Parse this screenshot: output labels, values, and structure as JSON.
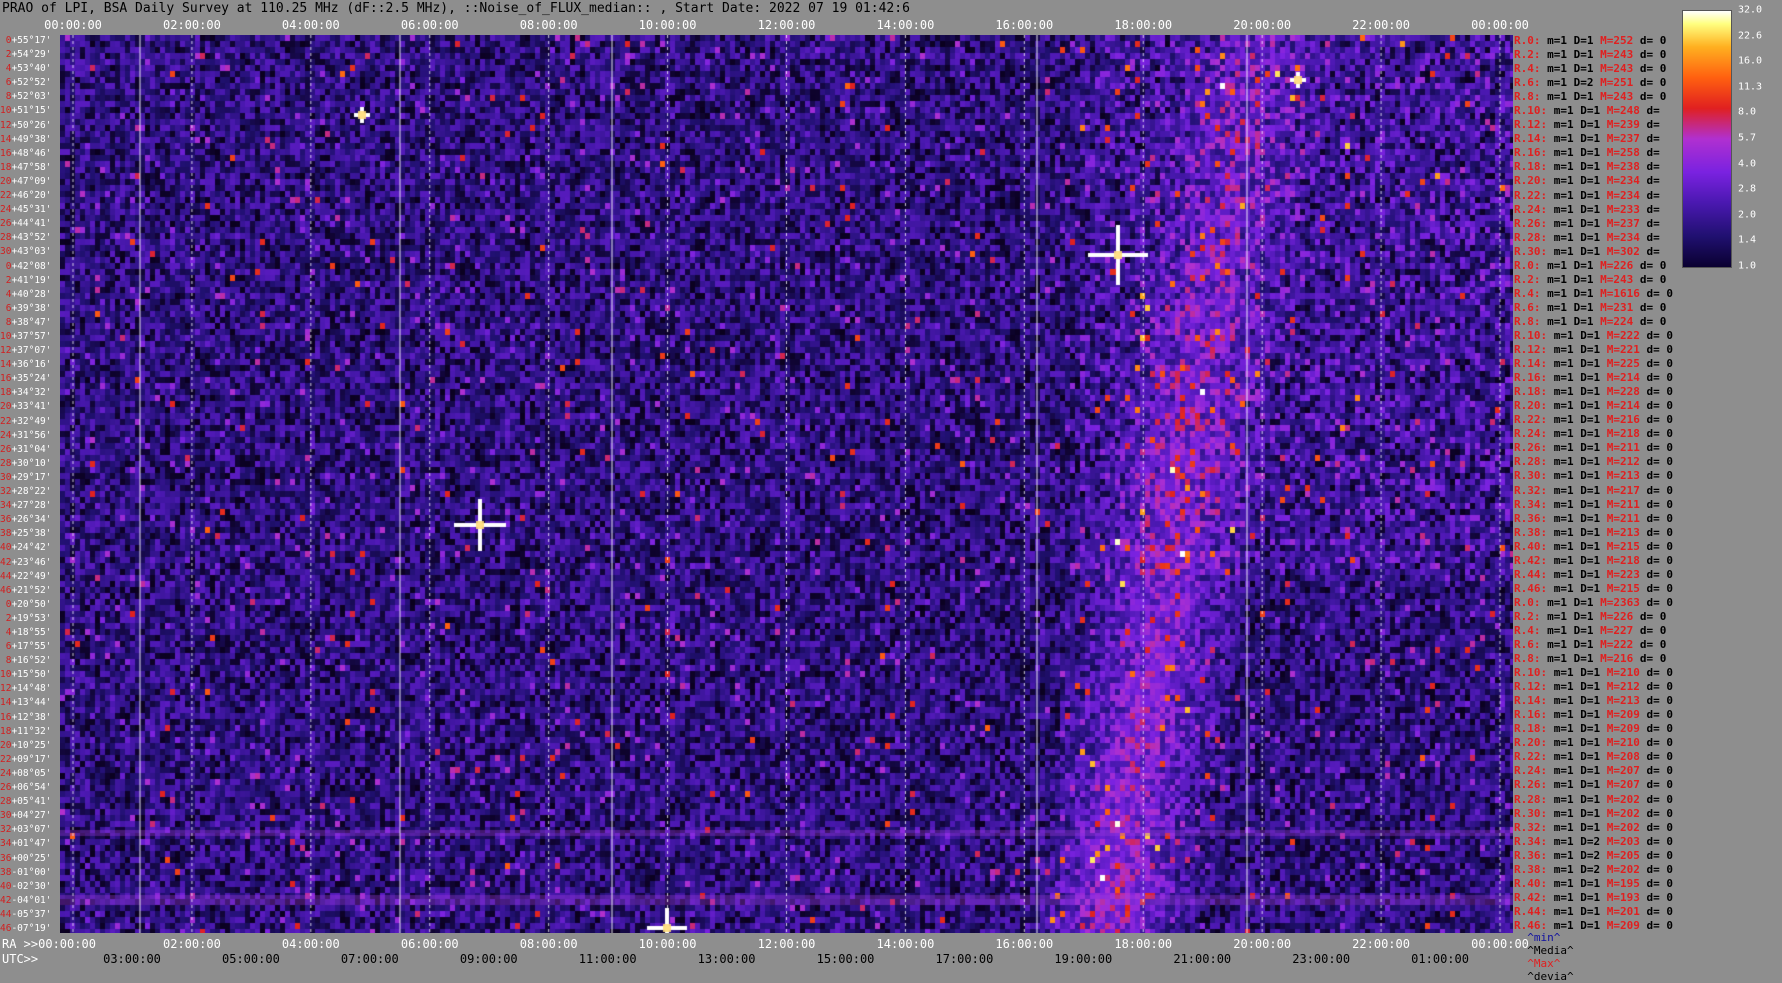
{
  "title": "PRAO of LPI, BSA Daily Survey at 110.25 MHz (dF::2.5 MHz), ::Noise_of_FLUX_median:: , Start Date: 2022 07 19 01:42:6",
  "top_ticks": [
    "00:00:00",
    "02:00:00",
    "04:00:00",
    "06:00:00",
    "08:00:00",
    "10:00:00",
    "12:00:00",
    "14:00:00",
    "16:00:00",
    "18:00:00",
    "20:00:00",
    "22:00:00",
    "00:00:00"
  ],
  "ra_label": "RA >>00:00:00",
  "ra_ticks": [
    "02:00:00",
    "04:00:00",
    "06:00:00",
    "08:00:00",
    "10:00:00",
    "12:00:00",
    "14:00:00",
    "16:00:00",
    "18:00:00",
    "20:00:00",
    "22:00:00",
    "00:00:00"
  ],
  "utc_label": "UTC>>",
  "utc_ticks": [
    "03:00:00",
    "05:00:00",
    "07:00:00",
    "09:00:00",
    "11:00:00",
    "13:00:00",
    "15:00:00",
    "17:00:00",
    "19:00:00",
    "21:00:00",
    "23:00:00",
    "01:00:00"
  ],
  "declinations": [
    {
      "i": "0",
      "v": "+55°17'"
    },
    {
      "i": "2",
      "v": "+54°29'"
    },
    {
      "i": "4",
      "v": "+53°40'"
    },
    {
      "i": "6",
      "v": "+52°52'"
    },
    {
      "i": "8",
      "v": "+52°03'"
    },
    {
      "i": "10",
      "v": "+51°15'"
    },
    {
      "i": "12",
      "v": "+50°26'"
    },
    {
      "i": "14",
      "v": "+49°38'"
    },
    {
      "i": "16",
      "v": "+48°46'"
    },
    {
      "i": "18",
      "v": "+47°58'"
    },
    {
      "i": "20",
      "v": "+47°09'"
    },
    {
      "i": "22",
      "v": "+46°20'"
    },
    {
      "i": "24",
      "v": "+45°31'"
    },
    {
      "i": "26",
      "v": "+44°41'"
    },
    {
      "i": "28",
      "v": "+43°52'"
    },
    {
      "i": "30",
      "v": "+43°03'"
    },
    {
      "i": "0",
      "v": "+42°08'"
    },
    {
      "i": "2",
      "v": "+41°19'"
    },
    {
      "i": "4",
      "v": "+40°28'"
    },
    {
      "i": "6",
      "v": "+39°38'"
    },
    {
      "i": "8",
      "v": "+38°47'"
    },
    {
      "i": "10",
      "v": "+37°57'"
    },
    {
      "i": "12",
      "v": "+37°07'"
    },
    {
      "i": "14",
      "v": "+36°16'"
    },
    {
      "i": "16",
      "v": "+35°24'"
    },
    {
      "i": "18",
      "v": "+34°32'"
    },
    {
      "i": "20",
      "v": "+33°41'"
    },
    {
      "i": "22",
      "v": "+32°49'"
    },
    {
      "i": "24",
      "v": "+31°56'"
    },
    {
      "i": "26",
      "v": "+31°04'"
    },
    {
      "i": "28",
      "v": "+30°10'"
    },
    {
      "i": "30",
      "v": "+29°17'"
    },
    {
      "i": "32",
      "v": "+28°22'"
    },
    {
      "i": "34",
      "v": "+27°28'"
    },
    {
      "i": "36",
      "v": "+26°34'"
    },
    {
      "i": "38",
      "v": "+25°38'"
    },
    {
      "i": "40",
      "v": "+24°42'"
    },
    {
      "i": "42",
      "v": "+23°46'"
    },
    {
      "i": "44",
      "v": "+22°49'"
    },
    {
      "i": "46",
      "v": "+21°52'"
    },
    {
      "i": "0",
      "v": "+20°50'"
    },
    {
      "i": "2",
      "v": "+19°53'"
    },
    {
      "i": "4",
      "v": "+18°55'"
    },
    {
      "i": "6",
      "v": "+17°55'"
    },
    {
      "i": "8",
      "v": "+16°52'"
    },
    {
      "i": "10",
      "v": "+15°50'"
    },
    {
      "i": "12",
      "v": "+14°48'"
    },
    {
      "i": "14",
      "v": "+13°44'"
    },
    {
      "i": "16",
      "v": "+12°38'"
    },
    {
      "i": "18",
      "v": "+11°32'"
    },
    {
      "i": "20",
      "v": "+10°25'"
    },
    {
      "i": "22",
      "v": "+09°17'"
    },
    {
      "i": "24",
      "v": "+08°05'"
    },
    {
      "i": "26",
      "v": "+06°54'"
    },
    {
      "i": "28",
      "v": "+05°41'"
    },
    {
      "i": "30",
      "v": "+04°27'"
    },
    {
      "i": "32",
      "v": "+03°07'"
    },
    {
      "i": "34",
      "v": "+01°47'"
    },
    {
      "i": "36",
      "v": "+00°25'"
    },
    {
      "i": "38",
      "v": "-01°00'"
    },
    {
      "i": "40",
      "v": "-02°30'"
    },
    {
      "i": "42",
      "v": "-04°01'"
    },
    {
      "i": "44",
      "v": "-05°37'"
    },
    {
      "i": "46",
      "v": "-07°19'"
    }
  ],
  "rows": [
    {
      "r": "R.0:",
      "mD": "m=1 D=1",
      "M": "M=252",
      "d": "d= 0"
    },
    {
      "r": "R.2:",
      "mD": "m=1 D=1",
      "M": "M=243",
      "d": "d= 0"
    },
    {
      "r": "R.4:",
      "mD": "m=1 D=1",
      "M": "M=243",
      "d": "d= 0"
    },
    {
      "r": "R.6:",
      "mD": "m=1 D=2",
      "M": "M=251",
      "d": "d= 0"
    },
    {
      "r": "R.8:",
      "mD": "m=1 D=1",
      "M": "M=243",
      "d": "d= 0"
    },
    {
      "r": "R.10:",
      "mD": "m=1 D=1",
      "M": "M=248",
      "d": "d="
    },
    {
      "r": "R.12:",
      "mD": "m=1 D=1",
      "M": "M=239",
      "d": "d="
    },
    {
      "r": "R.14:",
      "mD": "m=1 D=1",
      "M": "M=237",
      "d": "d="
    },
    {
      "r": "R.16:",
      "mD": "m=1 D=1",
      "M": "M=258",
      "d": "d="
    },
    {
      "r": "R.18:",
      "mD": "m=1 D=1",
      "M": "M=238",
      "d": "d="
    },
    {
      "r": "R.20:",
      "mD": "m=1 D=1",
      "M": "M=234",
      "d": "d="
    },
    {
      "r": "R.22:",
      "mD": "m=1 D=1",
      "M": "M=234",
      "d": "d="
    },
    {
      "r": "R.24:",
      "mD": "m=1 D=1",
      "M": "M=233",
      "d": "d="
    },
    {
      "r": "R.26:",
      "mD": "m=1 D=1",
      "M": "M=237",
      "d": "d="
    },
    {
      "r": "R.28:",
      "mD": "m=1 D=1",
      "M": "M=234",
      "d": "d="
    },
    {
      "r": "R.30:",
      "mD": "m=1 D=1",
      "M": "M=302",
      "d": "d="
    },
    {
      "r": "R.0:",
      "mD": "m=1 D=1",
      "M": "M=226",
      "d": "d= 0"
    },
    {
      "r": "R.2:",
      "mD": "m=1 D=1",
      "M": "M=243",
      "d": "d= 0"
    },
    {
      "r": "R.4:",
      "mD": "m=1 D=1",
      "M": "M=1616",
      "d": "d= 0"
    },
    {
      "r": "R.6:",
      "mD": "m=1 D=1",
      "M": "M=231",
      "d": "d= 0"
    },
    {
      "r": "R.8:",
      "mD": "m=1 D=1",
      "M": "M=224",
      "d": "d= 0"
    },
    {
      "r": "R.10:",
      "mD": "m=1 D=1",
      "M": "M=222",
      "d": "d= 0"
    },
    {
      "r": "R.12:",
      "mD": "m=1 D=1",
      "M": "M=221",
      "d": "d= 0"
    },
    {
      "r": "R.14:",
      "mD": "m=1 D=1",
      "M": "M=225",
      "d": "d= 0"
    },
    {
      "r": "R.16:",
      "mD": "m=1 D=1",
      "M": "M=214",
      "d": "d= 0"
    },
    {
      "r": "R.18:",
      "mD": "m=1 D=1",
      "M": "M=228",
      "d": "d= 0"
    },
    {
      "r": "R.20:",
      "mD": "m=1 D=1",
      "M": "M=214",
      "d": "d= 0"
    },
    {
      "r": "R.22:",
      "mD": "m=1 D=1",
      "M": "M=216",
      "d": "d= 0"
    },
    {
      "r": "R.24:",
      "mD": "m=1 D=1",
      "M": "M=218",
      "d": "d= 0"
    },
    {
      "r": "R.26:",
      "mD": "m=1 D=1",
      "M": "M=211",
      "d": "d= 0"
    },
    {
      "r": "R.28:",
      "mD": "m=1 D=1",
      "M": "M=212",
      "d": "d= 0"
    },
    {
      "r": "R.30:",
      "mD": "m=1 D=1",
      "M": "M=213",
      "d": "d= 0"
    },
    {
      "r": "R.32:",
      "mD": "m=1 D=1",
      "M": "M=217",
      "d": "d= 0"
    },
    {
      "r": "R.34:",
      "mD": "m=1 D=1",
      "M": "M=211",
      "d": "d= 0"
    },
    {
      "r": "R.36:",
      "mD": "m=1 D=1",
      "M": "M=211",
      "d": "d= 0"
    },
    {
      "r": "R.38:",
      "mD": "m=1 D=1",
      "M": "M=213",
      "d": "d= 0"
    },
    {
      "r": "R.40:",
      "mD": "m=1 D=1",
      "M": "M=215",
      "d": "d= 0"
    },
    {
      "r": "R.42:",
      "mD": "m=1 D=1",
      "M": "M=218",
      "d": "d= 0"
    },
    {
      "r": "R.44:",
      "mD": "m=1 D=1",
      "M": "M=223",
      "d": "d= 0"
    },
    {
      "r": "R.46:",
      "mD": "m=1 D=1",
      "M": "M=215",
      "d": "d= 0"
    },
    {
      "r": "R.0:",
      "mD": "m=1 D=1",
      "M": "M=2363",
      "d": "d= 0"
    },
    {
      "r": "R.2:",
      "mD": "m=1 D=1",
      "M": "M=226",
      "d": "d= 0"
    },
    {
      "r": "R.4:",
      "mD": "m=1 D=1",
      "M": "M=227",
      "d": "d= 0"
    },
    {
      "r": "R.6:",
      "mD": "m=1 D=1",
      "M": "M=222",
      "d": "d= 0"
    },
    {
      "r": "R.8:",
      "mD": "m=1 D=1",
      "M": "M=216",
      "d": "d= 0"
    },
    {
      "r": "R.10:",
      "mD": "m=1 D=1",
      "M": "M=210",
      "d": "d= 0"
    },
    {
      "r": "R.12:",
      "mD": "m=1 D=1",
      "M": "M=212",
      "d": "d= 0"
    },
    {
      "r": "R.14:",
      "mD": "m=1 D=1",
      "M": "M=213",
      "d": "d= 0"
    },
    {
      "r": "R.16:",
      "mD": "m=1 D=1",
      "M": "M=209",
      "d": "d= 0"
    },
    {
      "r": "R.18:",
      "mD": "m=1 D=1",
      "M": "M=209",
      "d": "d= 0"
    },
    {
      "r": "R.20:",
      "mD": "m=1 D=1",
      "M": "M=210",
      "d": "d= 0"
    },
    {
      "r": "R.22:",
      "mD": "m=1 D=1",
      "M": "M=208",
      "d": "d= 0"
    },
    {
      "r": "R.24:",
      "mD": "m=1 D=1",
      "M": "M=207",
      "d": "d= 0"
    },
    {
      "r": "R.26:",
      "mD": "m=1 D=1",
      "M": "M=207",
      "d": "d= 0"
    },
    {
      "r": "R.28:",
      "mD": "m=1 D=1",
      "M": "M=202",
      "d": "d= 0"
    },
    {
      "r": "R.30:",
      "mD": "m=1 D=1",
      "M": "M=202",
      "d": "d= 0"
    },
    {
      "r": "R.32:",
      "mD": "m=1 D=1",
      "M": "M=202",
      "d": "d= 0"
    },
    {
      "r": "R.34:",
      "mD": "m=1 D=2",
      "M": "M=203",
      "d": "d= 0"
    },
    {
      "r": "R.36:",
      "mD": "m=1 D=2",
      "M": "M=205",
      "d": "d= 0"
    },
    {
      "r": "R.38:",
      "mD": "m=1 D=2",
      "M": "M=202",
      "d": "d= 0"
    },
    {
      "r": "R.40:",
      "mD": "m=1 D=1",
      "M": "M=195",
      "d": "d= 0"
    },
    {
      "r": "R.42:",
      "mD": "m=1 D=1",
      "M": "M=193",
      "d": "d= 0"
    },
    {
      "r": "R.44:",
      "mD": "m=1 D=1",
      "M": "M=201",
      "d": "d= 0"
    },
    {
      "r": "R.46:",
      "mD": "m=1 D=1",
      "M": "M=209",
      "d": "d= 0"
    }
  ],
  "legend": {
    "min": "^min^",
    "median": "^Media^",
    "max": "^Max^",
    "dev": "^devia^"
  },
  "colorbar_ticks": [
    "32.0",
    "22.6",
    "16.0",
    "11.3",
    "8.0",
    "5.7",
    "4.0",
    "2.8",
    "2.0",
    "1.4",
    "1.0"
  ]
}
